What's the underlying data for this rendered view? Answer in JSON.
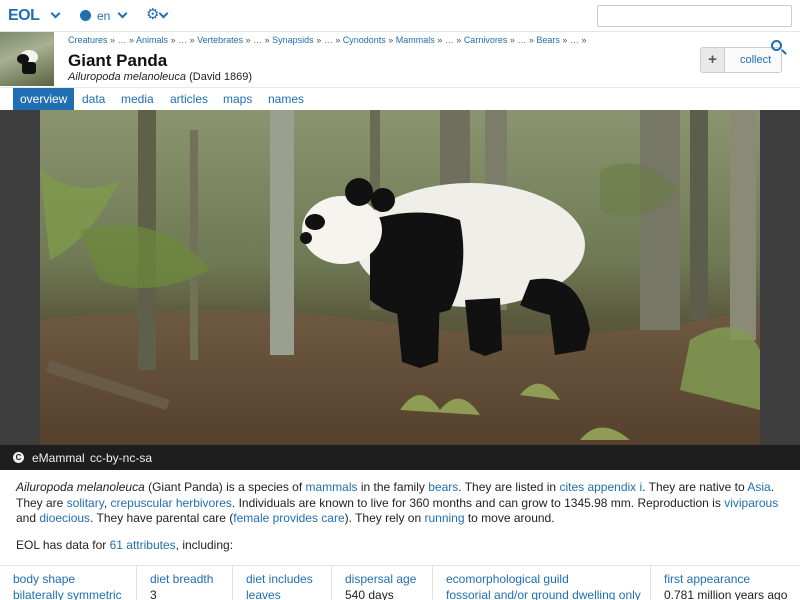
{
  "topbar": {
    "logo": "EOL",
    "language": "en",
    "search_placeholder": ""
  },
  "header": {
    "breadcrumbs": [
      {
        "label": "Creatures",
        "link": true
      },
      {
        "label": "…",
        "link": false
      },
      {
        "label": "Animals",
        "link": true
      },
      {
        "label": "…",
        "link": false
      },
      {
        "label": "Vertebrates",
        "link": true
      },
      {
        "label": "…",
        "link": false
      },
      {
        "label": "Synapsids",
        "link": true
      },
      {
        "label": "…",
        "link": false
      },
      {
        "label": "Cynodonts",
        "link": true
      },
      {
        "label": "Mammals",
        "link": true
      },
      {
        "label": "…",
        "link": false
      },
      {
        "label": "Carnivores",
        "link": true
      },
      {
        "label": "…",
        "link": false
      },
      {
        "label": "Bears",
        "link": true
      },
      {
        "label": "…",
        "link": false
      }
    ],
    "separator": "»",
    "title": "Giant Panda",
    "scientific_name": "Ailuropoda melanoleuca",
    "authority": "(David 1869)",
    "collect_label": "collect",
    "collect_plus": "+"
  },
  "tabs": [
    {
      "label": "overview",
      "active": true
    },
    {
      "label": "data",
      "active": false
    },
    {
      "label": "media",
      "active": false
    },
    {
      "label": "articles",
      "active": false
    },
    {
      "label": "maps",
      "active": false
    },
    {
      "label": "names",
      "active": false
    }
  ],
  "image": {
    "credit_icon": "C",
    "source": "eMammal",
    "license": "cc-by-nc-sa"
  },
  "description": {
    "s1": "Ailuropoda melanoleuca",
    "s2": " (Giant Panda) is a species of ",
    "s3": "mammals",
    "s4": " in the family ",
    "s5": "bears",
    "s6": ". They are listed in ",
    "s7": "cites appendix i",
    "s8": ". They are native to ",
    "s9": "Asia",
    "s10": ". They are ",
    "s11": "solitary",
    "s12": ", ",
    "s13": "crepuscular",
    "s14": " ",
    "s15": "herbivores",
    "s16": ". Individuals are known to live for 360 months and can grow to 1345.98 mm. Reproduction is ",
    "s17": "viviparous",
    "s18": " and ",
    "s19": "dioecious",
    "s20": ". They have parental care (",
    "s21": "female provides care",
    "s22": "). They rely on ",
    "s23": "running",
    "s24": " to move around."
  },
  "attributes_line": {
    "prefix": "EOL has data for ",
    "link": "61 attributes",
    "suffix": ", including:"
  },
  "data_cards": [
    {
      "key": "body shape",
      "value": "bilaterally symmetric",
      "value_link": true
    },
    {
      "key": "diet breadth",
      "value": "3",
      "value_link": false
    },
    {
      "key": "diet includes",
      "value": "leaves",
      "value_link": true
    },
    {
      "key": "dispersal age",
      "value": "540 days",
      "value_link": false
    },
    {
      "key": "ecomorphological guild",
      "value": "fossorial and/or ground dwelling only",
      "value_link": true
    },
    {
      "key": "first appearance",
      "value": "0.781 million years ago",
      "value_link": false
    }
  ],
  "colors": {
    "accent": "#1f6fb2",
    "active_tab_bg": "#1f6fb2",
    "credit_bar": "#1e1e1e"
  },
  "icons": [
    "eol-logo",
    "chevron-down-icon",
    "globe-icon",
    "gear-icon",
    "search-icon",
    "plus-icon",
    "copyright-icon"
  ]
}
